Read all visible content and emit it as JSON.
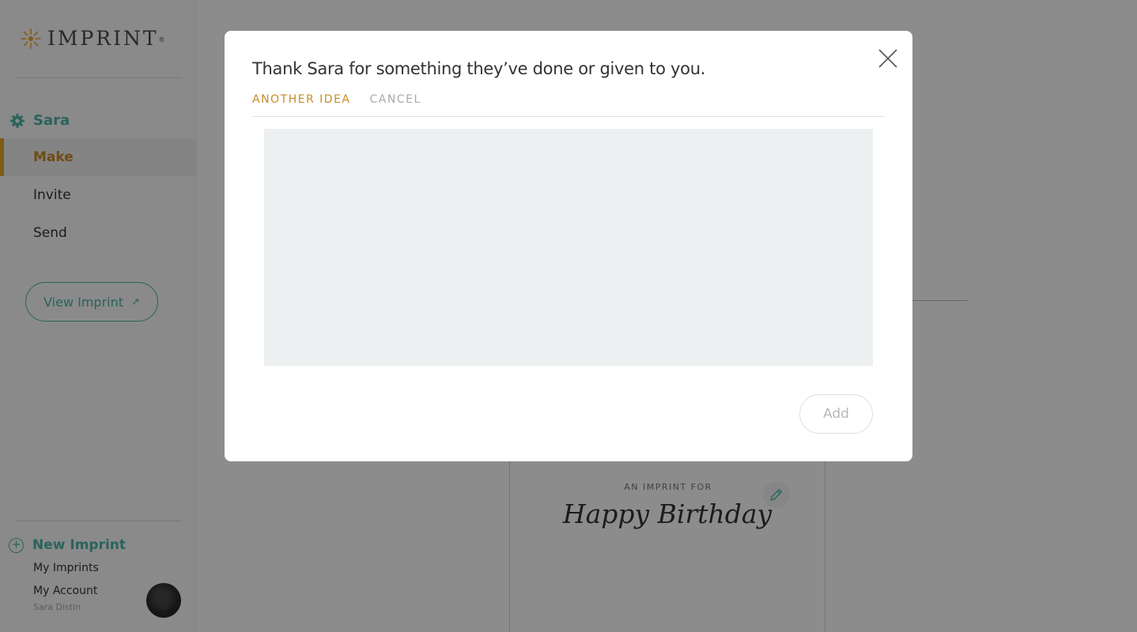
{
  "sidebar": {
    "logo_text": "IMPRINT",
    "logo_mark": "®",
    "user_name": "Sara",
    "nav": [
      {
        "label": "Make",
        "active": true
      },
      {
        "label": "Invite",
        "active": false
      },
      {
        "label": "Send",
        "active": false
      }
    ],
    "view_button": "View Imprint",
    "view_button_icon": "↗",
    "new_imprint": "New Imprint",
    "new_imprint_icon": "+",
    "my_imprints": "My Imprints",
    "my_account": "My Account",
    "account_name": "Sara Distin"
  },
  "card": {
    "label": "AN IMPRINT FOR",
    "title": "Happy Birthday"
  },
  "modal": {
    "title": "Thank Sara for something they’ve done or given to you.",
    "another_idea": "ANOTHER IDEA",
    "cancel": "CANCEL",
    "textarea_value": "",
    "add_button": "Add"
  },
  "colors": {
    "accent_teal": "#4cb4a8",
    "accent_gold": "#c98b24",
    "active_bar": "#e9a82e",
    "textarea_bg": "#edf0f1"
  },
  "icons": [
    "sun-logo-icon",
    "gear-icon",
    "external-link-icon",
    "plus-circle-icon",
    "pencil-icon",
    "close-icon"
  ]
}
